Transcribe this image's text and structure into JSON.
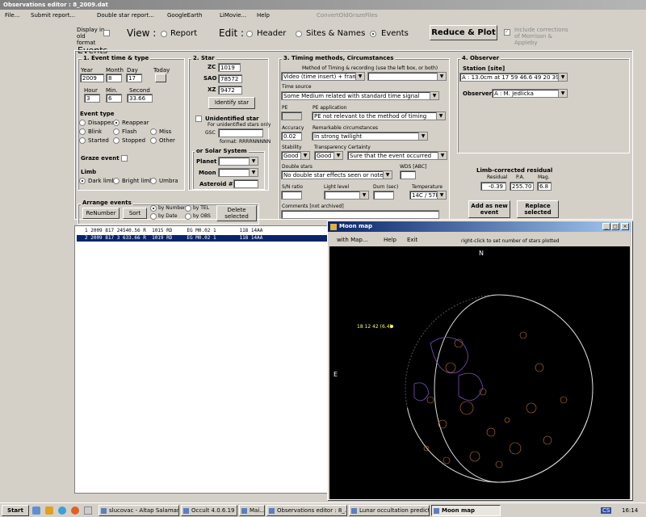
{
  "window": {
    "title": "Observations editor : 8_2009.dat"
  },
  "menu": [
    "File...",
    "Submit report...",
    "Double star report...",
    "GoogleEarth",
    "LiMovie...",
    "Help",
    "ConvertOldGrazeFiles"
  ],
  "top": {
    "display_old": "Display in old format",
    "view_label": "View :",
    "view_report": "Report",
    "edit_label": "Edit :",
    "edit_header": "Header",
    "edit_sites": "Sites & Names",
    "edit_events": "Events",
    "reduce_btn": "Reduce & Plot",
    "include_corr": "Include corrections of Morrison & Appleby"
  },
  "events_title": "Events",
  "event_time": {
    "title": "1.  Event time & type",
    "year_l": "Year",
    "year": "2009",
    "month_l": "Month",
    "month": "8",
    "day_l": "Day",
    "day": "17",
    "today": "Today",
    "hour_l": "Hour",
    "hour": "3",
    "min_l": "Min.",
    "min": "6",
    "sec_l": "Second",
    "sec": "33.66",
    "type_title": "Event type",
    "types": [
      "Disappear",
      "Reappear",
      "Blink",
      "Flash",
      "Miss",
      "Started",
      "Stopped",
      "Other"
    ],
    "graze": "Graze event",
    "limb_title": "Limb",
    "limbs": [
      "Dark limb",
      "Bright limb",
      "Umbra"
    ]
  },
  "star": {
    "title": "2.  Star",
    "zc_l": "ZC",
    "zc": "1019",
    "sao_l": "SAO",
    "sao": "78572",
    "xz_l": "XZ",
    "xz": "9472",
    "identify": "Identify star",
    "unident": "Unidentified star",
    "unident_note": "For unidentified stars only",
    "gsc_l": "GSC",
    "format": "format: RRRRNNNNN",
    "solar_title": "or  Solar System",
    "planet_l": "Planet",
    "moon_l": "Moon",
    "asteroid_l": "Asteroid #"
  },
  "timing": {
    "title": "3.  Timing methods, Circumstances",
    "method_l": "Method of Timing & recording (use the left box, or both)",
    "method": "Video (time insert) + frame an",
    "source_l": "Time source",
    "source": "Some Medium related with standard time signal",
    "pe_l": "PE",
    "pe_app_l": "PE application",
    "pe_app": "PE not relevant to the method of timing",
    "acc_l": "Accuracy",
    "acc": "0.02",
    "remark_l": "Remarkable circumstances",
    "remark": "In strong twilight",
    "stab_l": "Stability",
    "stab": "Good",
    "transp_l": "Transparency",
    "transp": "Good",
    "cert_l": "Certainty",
    "cert": "Sure that the event occurred",
    "double_l": "Double stars",
    "double": "No double star effects seen or noted",
    "wds_l": "WDS [ABC]",
    "sn_l": "S/N ratio",
    "light_l": "Light level",
    "durn_l": "Durn (sec)",
    "temp_l": "Temperature",
    "temp": "14C / 57F",
    "comments_l": "Comments   [not archived]"
  },
  "observer": {
    "title": "4.  Observer",
    "station_l": "Station [site]",
    "station": "A : 13.0cm at    17 59 46.6  49 20 39.1",
    "observer_l": "Observer",
    "observer": "A : M. Jedlicka"
  },
  "residual": {
    "title": "Limb-corrected residual",
    "res_l": "Residual",
    "pa_l": "P.A.",
    "mag_l": "Mag.",
    "res": "-0.39",
    "pa": "255.70",
    "mag": "6.8"
  },
  "add_btn": "Add as new event",
  "replace_btn": "Replace selected",
  "arrange": {
    "title": "Arrange events",
    "renumber": "ReNumber",
    "sort": "Sort",
    "by_number": "by Number",
    "by_date": "by Date",
    "by_tel": "by TEL",
    "by_obs": "by OBS",
    "delete": "Delete selected"
  },
  "events_list": [
    "1 2009 817 24540.56 R  1015 RD     EG M0.02 1        118 14AA",
    "2 2009 817 3 633.66 R  1019 RD     EG M0.02 1        118 14AA"
  ],
  "moon_map": {
    "title": "Moon map",
    "menu": [
      "with Map...",
      "Help",
      "Exit"
    ],
    "hint": "right-click to set number of stars plotted",
    "north": "N",
    "east": "E",
    "star_label": "18 12 42 (6.4)"
  },
  "taskbar": {
    "start": "Start",
    "items": [
      "slucovac - Altap Salaman...",
      "Occult 4.0.6.19",
      "Mai...",
      "Observations editor : 8_...",
      "Lunar occultation predicti...",
      "Moon map"
    ],
    "lang": "CS",
    "clock": "16:14"
  },
  "colors": {
    "title_active": "#0a246a",
    "moon_bg": "#000000",
    "moon_features": "#c8782a",
    "moon_maria": "#7a4fbe"
  }
}
